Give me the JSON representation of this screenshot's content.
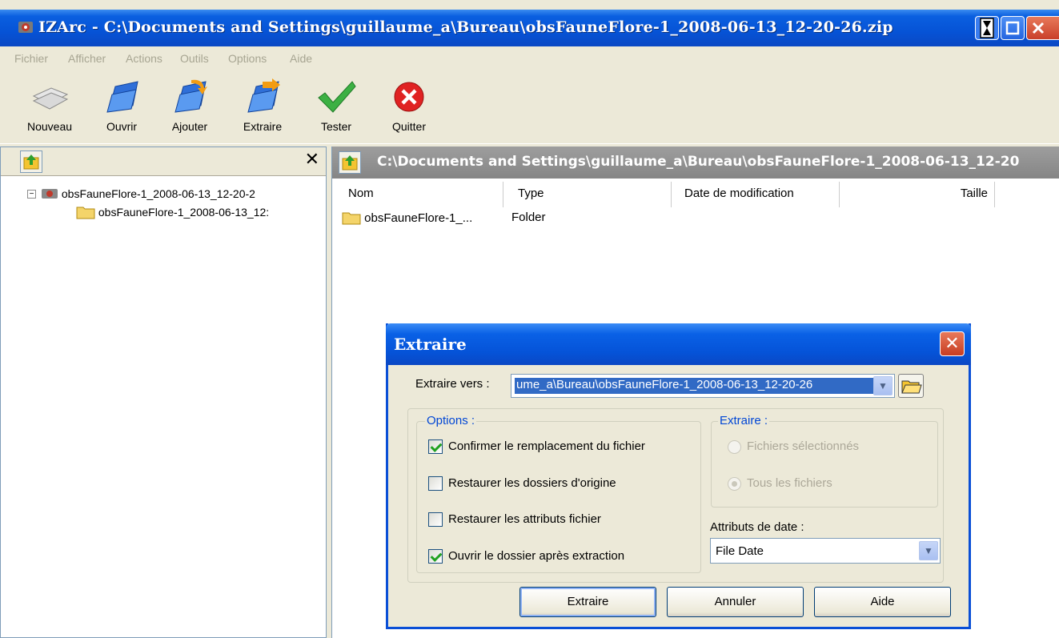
{
  "window": {
    "title": "IZArc - C:\\Documents and Settings\\guillaume_a\\Bureau\\obsFauneFlore-1_2008-06-13_12-20-26.zip"
  },
  "menu": [
    "Fichier",
    "Afficher",
    "Actions",
    "Outils",
    "Options",
    "Aide"
  ],
  "toolbar": {
    "items": [
      {
        "label": "Nouveau",
        "icon": "new-archive-icon"
      },
      {
        "label": "Ouvrir",
        "icon": "open-folder-icon"
      },
      {
        "label": "Ajouter",
        "icon": "add-folder-icon"
      },
      {
        "label": "Extraire",
        "icon": "extract-folder-icon"
      },
      {
        "label": "Tester",
        "icon": "checkmark-icon"
      },
      {
        "label": "Quitter",
        "icon": "quit-icon"
      }
    ]
  },
  "left_pane": {
    "close_glyph": "✕",
    "expander_glyph": "−",
    "tree": [
      {
        "label": "obsFauneFlore-1_2008-06-13_12-20-2",
        "icon": "archive-icon"
      },
      {
        "label": "obsFauneFlore-1_2008-06-13_12:",
        "icon": "folder-icon"
      }
    ]
  },
  "right_pane": {
    "path": "C:\\Documents and Settings\\guillaume_a\\Bureau\\obsFauneFlore-1_2008-06-13_12-20",
    "columns": [
      "Nom",
      "Type",
      "Date de modification",
      "Taille"
    ],
    "rows": [
      {
        "name": "obsFauneFlore-1_...",
        "type": "Folder"
      }
    ]
  },
  "dialog": {
    "title": "Extraire",
    "close_glyph": "✕",
    "extract_to_label": "Extraire vers :",
    "extract_to_value": "ume_a\\Bureau\\obsFauneFlore-1_2008-06-13_12-20-26",
    "options_legend": "Options :",
    "options": [
      {
        "label": "Confirmer le remplacement du fichier",
        "checked": true
      },
      {
        "label": "Restaurer les dossiers d'origine",
        "checked": false
      },
      {
        "label": "Restaurer les attributs fichier",
        "checked": false
      },
      {
        "label": "Ouvrir le dossier après extraction",
        "checked": true
      }
    ],
    "extract_legend": "Extraire :",
    "extract_options": [
      {
        "label": "Fichiers sélectionnés",
        "selected": false
      },
      {
        "label": "Tous les fichiers",
        "selected": true
      }
    ],
    "date_attr_label": "Attributs de date :",
    "date_attr_value": "File Date",
    "buttons": {
      "extract": "Extraire",
      "cancel": "Annuler",
      "help": "Aide"
    }
  },
  "colors": {
    "title_blue": "#0653d6",
    "selection": "#316ac5",
    "legend_blue": "#0046d5",
    "check_green": "#21a121"
  }
}
